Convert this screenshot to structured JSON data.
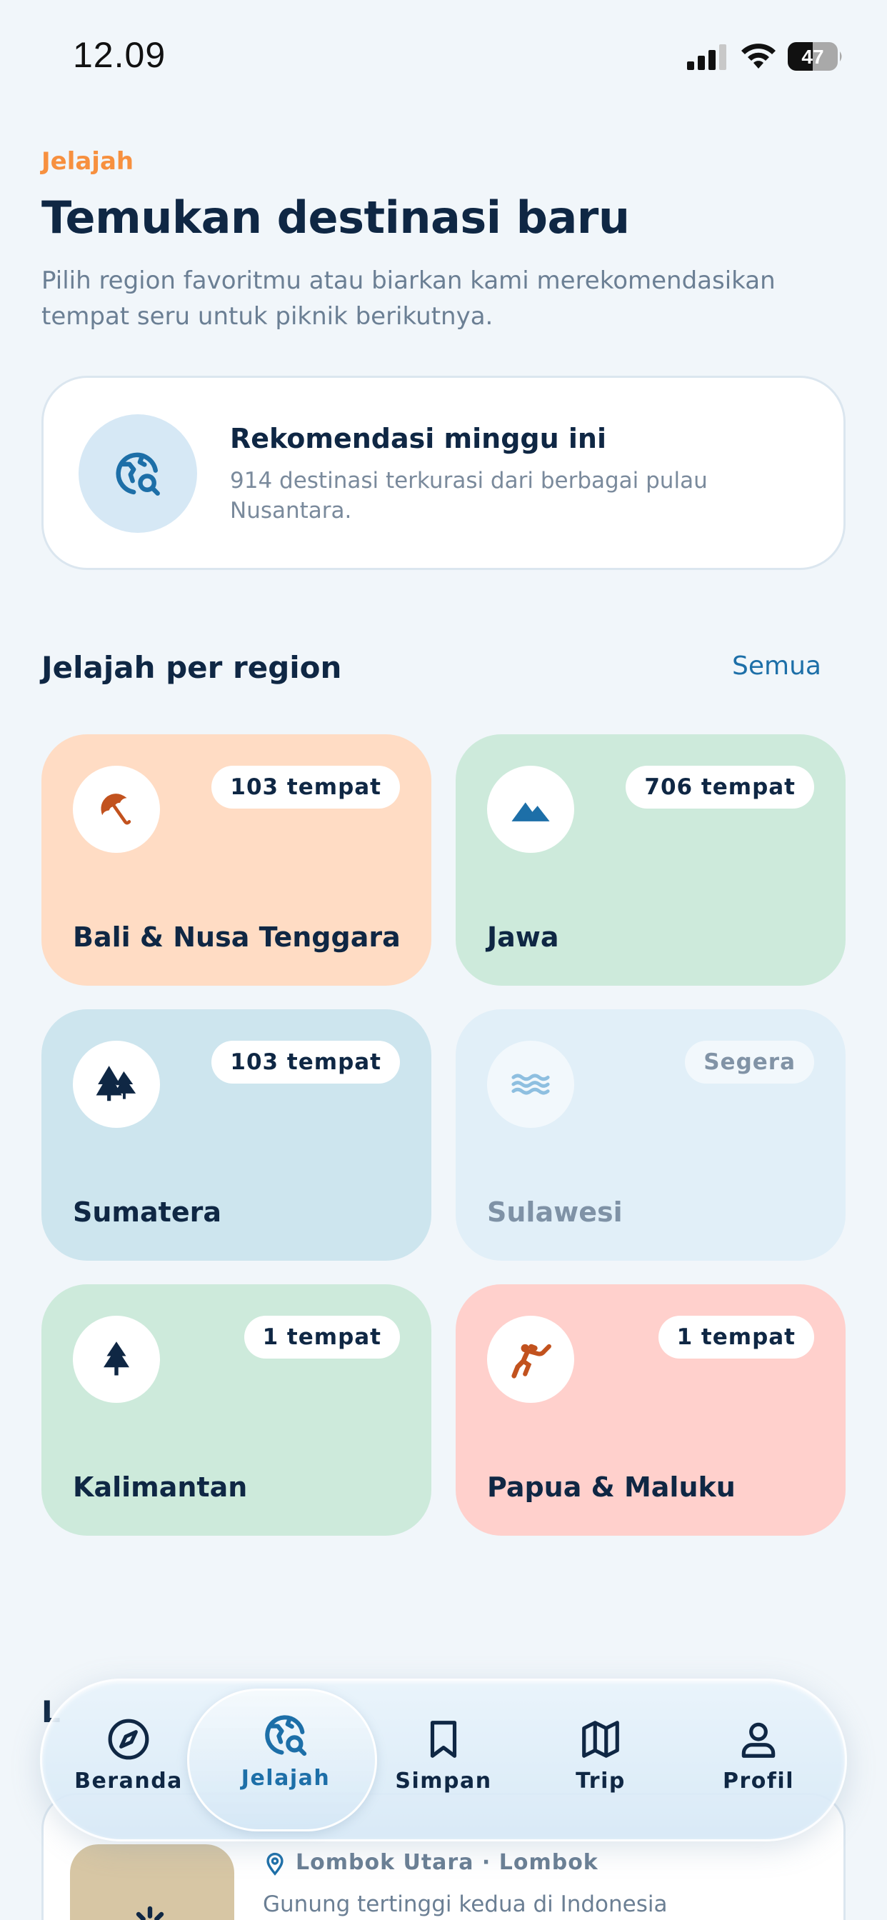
{
  "status_bar": {
    "time": "12.09",
    "battery": "47"
  },
  "header": {
    "eyebrow": "Jelajah",
    "title": "Temukan destinasi baru",
    "subtitle": "Pilih region favoritmu atau biarkan kami merekomendasikan tempat seru untuk piknik berikutnya."
  },
  "recommendation": {
    "title": "Rekomendasi minggu ini",
    "description": "914 destinasi terkurasi dari berbagai pulau Nusantara.",
    "icon": "globe-search-icon"
  },
  "regions_section": {
    "title": "Jelajah per region",
    "see_all": "Semua"
  },
  "regions": [
    {
      "name": "Bali & Nusa Tenggara",
      "badge": "103 tempat",
      "icon": "umbrella-icon",
      "bg": "#ffdcc4",
      "icon_color": "#c2521e"
    },
    {
      "name": "Jawa",
      "badge": "706 tempat",
      "icon": "mountain-icon",
      "bg": "#cdeadb",
      "icon_color": "#1d6fa8"
    },
    {
      "name": "Sumatera",
      "badge": "103 tempat",
      "icon": "trees-icon",
      "bg": "#cde5ee",
      "icon_color": "#0f2744"
    },
    {
      "name": "Sulawesi",
      "badge": "Segera",
      "icon": "waves-icon",
      "bg": "#e1eff8",
      "icon_color": "#8ebfe0",
      "disabled": true
    },
    {
      "name": "Kalimantan",
      "badge": "1 tempat",
      "icon": "tree-icon",
      "bg": "#cdeadb",
      "icon_color": "#0f2744"
    },
    {
      "name": "Papua & Maluku",
      "badge": "1 tempat",
      "icon": "diver-icon",
      "bg": "#ffd0cc",
      "icon_color": "#c2521e"
    }
  ],
  "peek": {
    "section_initial": "L",
    "location": "Lombok Utara · Lombok",
    "description": "Gunung tertinggi kedua di Indonesia"
  },
  "nav": [
    {
      "label": "Beranda",
      "icon": "compass-icon"
    },
    {
      "label": "Jelajah",
      "icon": "globe-search-icon",
      "active": true
    },
    {
      "label": "Simpan",
      "icon": "bookmark-icon"
    },
    {
      "label": "Trip",
      "icon": "map-icon"
    },
    {
      "label": "Profil",
      "icon": "user-icon"
    }
  ],
  "colors": {
    "accent": "#f7903f",
    "primary": "#0f2744",
    "link": "#1d6fa8",
    "background": "#f1f6fa"
  }
}
